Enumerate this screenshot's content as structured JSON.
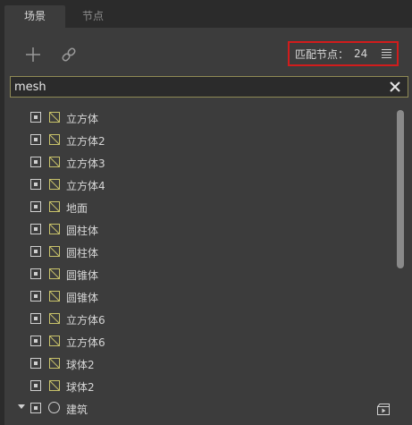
{
  "tabs": [
    {
      "label": "场景",
      "active": true
    },
    {
      "label": "节点",
      "active": false
    }
  ],
  "toolbar": {
    "add_icon": "plus-icon",
    "link_icon": "link-icon",
    "match_label": "匹配节点：",
    "match_count": "24",
    "menu_icon": "menu-icon"
  },
  "search": {
    "value": "mesh",
    "clear_icon": "close-icon"
  },
  "nodes": [
    {
      "label": "立方体",
      "icon": "mesh-icon"
    },
    {
      "label": "立方体2",
      "icon": "mesh-icon"
    },
    {
      "label": "立方体3",
      "icon": "mesh-icon"
    },
    {
      "label": "立方体4",
      "icon": "mesh-icon"
    },
    {
      "label": "地面",
      "icon": "mesh-icon"
    },
    {
      "label": "圆柱体",
      "icon": "mesh-icon"
    },
    {
      "label": "圆柱体",
      "icon": "mesh-icon"
    },
    {
      "label": "圆锥体",
      "icon": "mesh-icon"
    },
    {
      "label": "圆锥体",
      "icon": "mesh-icon"
    },
    {
      "label": "立方体6",
      "icon": "mesh-icon"
    },
    {
      "label": "立方体6",
      "icon": "mesh-icon"
    },
    {
      "label": "球体2",
      "icon": "mesh-icon"
    },
    {
      "label": "球体2",
      "icon": "mesh-icon"
    }
  ],
  "group_node": {
    "label": "建筑",
    "icon": "circle-icon",
    "expanded": true
  },
  "colors": {
    "highlight_border": "#d11c1c",
    "mesh_icon": "#c8c26a",
    "search_border": "#8f8a55"
  }
}
